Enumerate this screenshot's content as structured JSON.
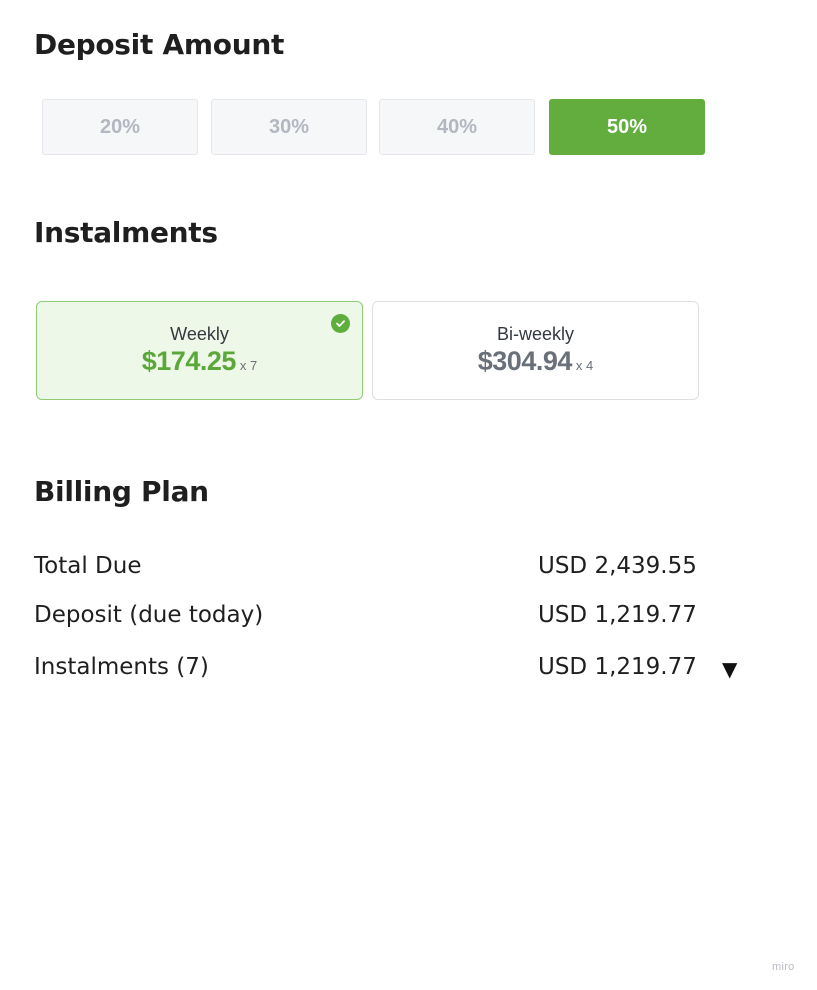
{
  "deposit": {
    "title": "Deposit Amount",
    "options": [
      "20%",
      "30%",
      "40%",
      "50%"
    ],
    "selected": "50%"
  },
  "instalments": {
    "title": "Instalments",
    "plans": [
      {
        "label": "Weekly",
        "price": "$174.25",
        "count": "x 7",
        "selected": true
      },
      {
        "label": "Bi-weekly",
        "price": "$304.94",
        "count": "x 4",
        "selected": false
      }
    ]
  },
  "billing": {
    "title": "Billing Plan",
    "rows": [
      {
        "label": "Total Due",
        "value": "USD 2,439.55"
      },
      {
        "label": "Deposit (due today)",
        "value": "USD 1,219.77"
      },
      {
        "label": "Instalments (7)",
        "value": "USD 1,219.77"
      }
    ],
    "expand_icon": "▼"
  },
  "watermark": "miro",
  "colors": {
    "accent": "#63ad3f",
    "selected_card_bg": "#eef8e8",
    "selected_card_border": "#8fcc72",
    "muted_text": "#b3b7bf"
  },
  "icons": {
    "check": "check-circle-icon",
    "expand": "caret-down-icon"
  }
}
